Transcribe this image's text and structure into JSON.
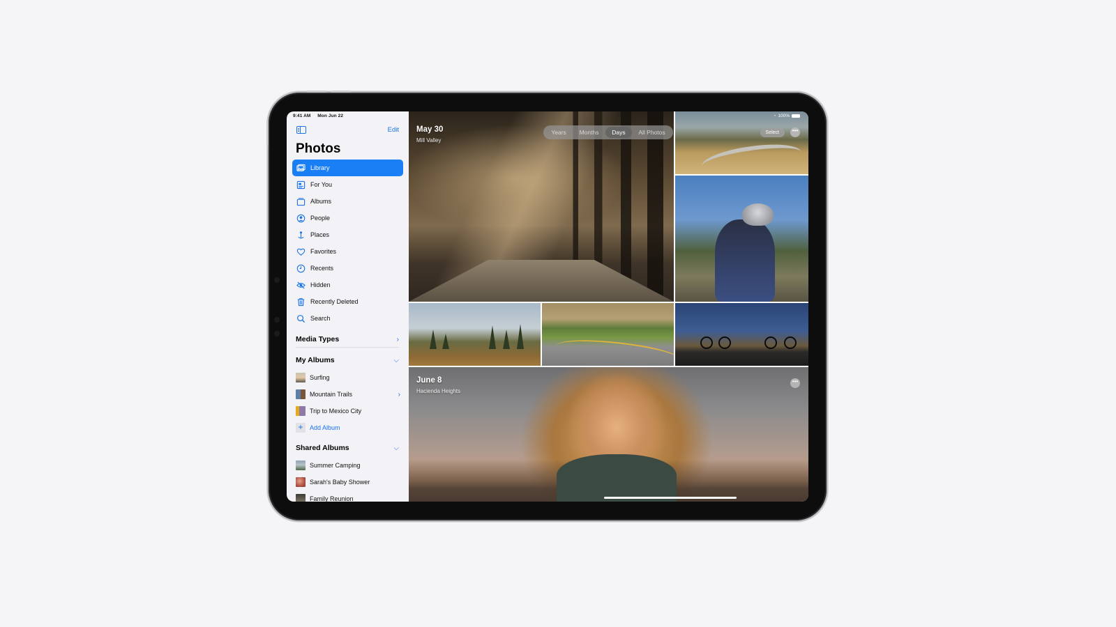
{
  "status_bar": {
    "time": "9:41 AM",
    "date": "Mon Jun 22",
    "battery": "100%"
  },
  "sidebar": {
    "toggle_icon": "sidebar-icon",
    "edit_label": "Edit",
    "title": "Photos",
    "items": [
      {
        "label": "Library",
        "icon": "library-icon",
        "active": true
      },
      {
        "label": "For You",
        "icon": "for-you-icon"
      },
      {
        "label": "Albums",
        "icon": "albums-icon"
      },
      {
        "label": "People",
        "icon": "people-icon"
      },
      {
        "label": "Places",
        "icon": "places-icon"
      },
      {
        "label": "Favorites",
        "icon": "heart-icon"
      },
      {
        "label": "Recents",
        "icon": "clock-icon"
      },
      {
        "label": "Hidden",
        "icon": "eye-slash-icon"
      },
      {
        "label": "Recently Deleted",
        "icon": "trash-icon"
      },
      {
        "label": "Search",
        "icon": "search-icon"
      }
    ],
    "media_types": {
      "label": "Media Types"
    },
    "my_albums": {
      "label": "My Albums",
      "items": [
        {
          "label": "Surfing"
        },
        {
          "label": "Mountain Trails",
          "has_children": true
        },
        {
          "label": "Trip to Mexico City"
        }
      ],
      "add_label": "Add Album"
    },
    "shared_albums": {
      "label": "Shared Albums",
      "items": [
        {
          "label": "Summer Camping"
        },
        {
          "label": "Sarah's Baby Shower"
        },
        {
          "label": "Family Reunion"
        }
      ]
    }
  },
  "main": {
    "view_tabs": [
      {
        "label": "Years"
      },
      {
        "label": "Months"
      },
      {
        "label": "Days",
        "active": true
      },
      {
        "label": "All Photos"
      }
    ],
    "select_label": "Select",
    "more_icon": "ellipsis-icon",
    "groups": [
      {
        "date": "May 30",
        "location": "Mill Valley"
      },
      {
        "date": "June 8",
        "location": "Hacienda Heights"
      }
    ]
  }
}
